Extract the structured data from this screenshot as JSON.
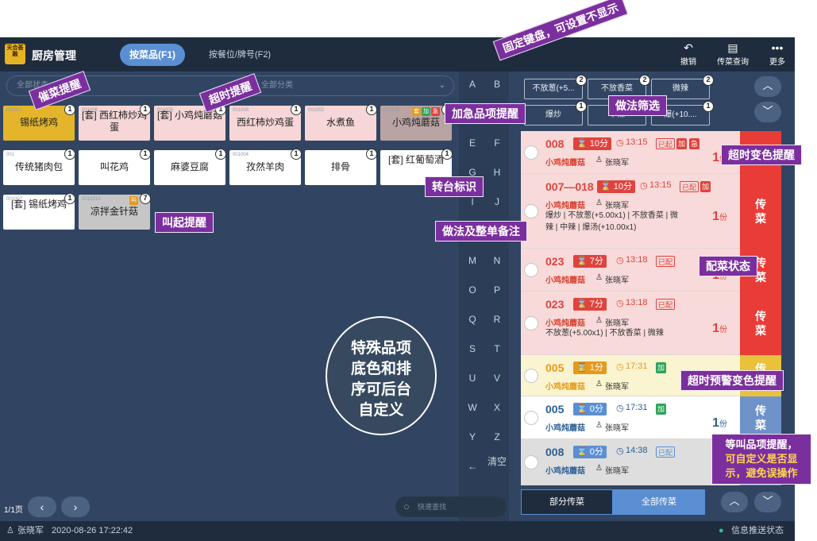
{
  "header": {
    "logo_text": "天合荟融",
    "title": "厨房管理",
    "tab_by_dish": "按菜品(F1)",
    "tab_by_table": "按餐位/牌号(F2)",
    "undo": "撤销",
    "query": "传菜查询",
    "more": "更多"
  },
  "filter": {
    "left": "全部状态",
    "mid": "全部分类"
  },
  "items": [
    {
      "code": "001007",
      "name": "锡纸烤鸡",
      "count": "1",
      "style": "gold"
    },
    {
      "code": "001006",
      "name": "[套] 西红柿炒鸡蛋",
      "count": "1",
      "style": "pink"
    },
    {
      "code": "001005",
      "name": "[套] 小鸡炖蘑菇",
      "count": "1",
      "style": "pink"
    },
    {
      "code": "001008",
      "name": "西红柿炒鸡蛋",
      "count": "1",
      "style": "pink"
    },
    {
      "code": "001002",
      "name": "水煮鱼",
      "count": "1",
      "style": "pink"
    },
    {
      "code": "001005",
      "name": "小鸡炖蘑菇",
      "count": "1",
      "style": "dark-pink",
      "tags": [
        "套",
        "加",
        "急"
      ]
    },
    {
      "code": "001",
      "name": "传统猪肉包",
      "count": "1",
      "style": "white"
    },
    {
      "code": "",
      "name": "叫花鸡",
      "count": "1",
      "style": "white"
    },
    {
      "code": "",
      "name": "麻婆豆腐",
      "count": "1",
      "style": "white"
    },
    {
      "code": "001004",
      "name": "孜然羊肉",
      "count": "1",
      "style": "white"
    },
    {
      "code": "",
      "name": "排骨",
      "count": "1",
      "style": "white"
    },
    {
      "code": "",
      "name": "[套] 红葡萄酒",
      "count": "1",
      "style": "white"
    },
    {
      "code": "001007",
      "name": "[套] 锡纸烤鸡",
      "count": "1",
      "style": "white"
    },
    {
      "code": "001001A",
      "name": "凉拌金针菇",
      "count": "7",
      "style": "gray",
      "tags": [
        "叫"
      ]
    }
  ],
  "alphabet": [
    "A",
    "B",
    "C",
    "D",
    "E",
    "F",
    "G",
    "H",
    "I",
    "J",
    "K",
    "L",
    "M",
    "N",
    "O",
    "P",
    "Q",
    "R",
    "S",
    "T",
    "U",
    "V",
    "W",
    "X",
    "Y",
    "Z",
    "←",
    "清空"
  ],
  "pager": {
    "label": "1/1页",
    "prev": "‹",
    "next": "›",
    "search_placeholder": "快速查找"
  },
  "methods": [
    {
      "label": "不放葱(+5...",
      "count": "2"
    },
    {
      "label": "不放香菜",
      "count": "2"
    },
    {
      "label": "微辣",
      "count": "2"
    },
    {
      "label": "爆炒",
      "count": "1"
    },
    {
      "label": "中辣",
      "count": "1"
    },
    {
      "label": "爆(+10....",
      "count": "1"
    }
  ],
  "orders": [
    {
      "num": "008",
      "timer": "10分",
      "time": "13:15",
      "badges": [
        "已起",
        "加",
        "急"
      ],
      "dish": "小鸡炖蘑菇",
      "who": "张晓军",
      "qty": "1",
      "unit": "份",
      "style": "pink",
      "side": ""
    },
    {
      "num": "007—018",
      "timer": "10分",
      "time": "13:15",
      "badges": [
        "已配",
        "加"
      ],
      "dish": "小鸡炖蘑菇",
      "who": "张晓军",
      "note": "爆炒 | 不放葱(+5.00x1) | 不放香菜 | 微辣 | 中辣 | 爆汤(+10.00x1)",
      "qty": "1",
      "unit": "份",
      "style": "pink",
      "side": "传菜"
    },
    {
      "num": "023",
      "timer": "7分",
      "time": "13:18",
      "badges": [
        "已配"
      ],
      "dish": "小鸡炖蘑菇",
      "who": "张晓军",
      "qty": "1",
      "unit": "份",
      "style": "pink",
      "side": "传菜"
    },
    {
      "num": "023",
      "timer": "7分",
      "time": "13:18",
      "badges": [
        "已配"
      ],
      "dish": "小鸡炖蘑菇",
      "who": "张晓军",
      "note": "不放葱(+5.00x1) | 不放香菜 | 微辣",
      "qty": "1",
      "unit": "份",
      "style": "pink",
      "side": "传菜"
    },
    {
      "num": "005",
      "timer": "1分",
      "time": "17:31",
      "badges": [
        "加"
      ],
      "dish": "小鸡炖蘑菇",
      "who": "张晓军",
      "qty": "1",
      "unit": "份",
      "style": "yellow",
      "side": "传菜"
    },
    {
      "num": "005",
      "timer": "0分",
      "time": "17:31",
      "badges": [
        "加"
      ],
      "dish": "小鸡炖蘑菇",
      "who": "张晓军",
      "qty": "1",
      "unit": "份",
      "style": "white",
      "side": "传菜"
    },
    {
      "num": "008",
      "timer": "0分",
      "time": "14:38",
      "badges": [
        "已配"
      ],
      "dish": "小鸡炖蘑菇",
      "who": "张晓军",
      "qty": "1",
      "unit": "份",
      "style": "gray",
      "side": "传菜"
    }
  ],
  "actions": {
    "partial": "部分传菜",
    "all": "全部传菜"
  },
  "status": {
    "user": "张晓军",
    "datetime": "2020-08-26 17:22:42",
    "push": "信息推送状态"
  },
  "annotations": {
    "fixed_keyboard": "固定键盘，可设置不显示",
    "remind": "催菜提醒",
    "overtime": "超时提醒",
    "urgent": "加急品项提醒",
    "method_filter": "做法筛选",
    "overtime_color": "超时变色提醒",
    "transfer": "转台标识",
    "notes": "做法及整单备注",
    "prep_status": "配菜状态",
    "call": "叫起提醒",
    "special": "特殊品项底色和排序可后台自定义",
    "warn_color": "超时预警变色提醒",
    "wait1": "等叫品项提醒，",
    "wait2": "可自定义是否显",
    "wait3": "示，避免误操作"
  }
}
